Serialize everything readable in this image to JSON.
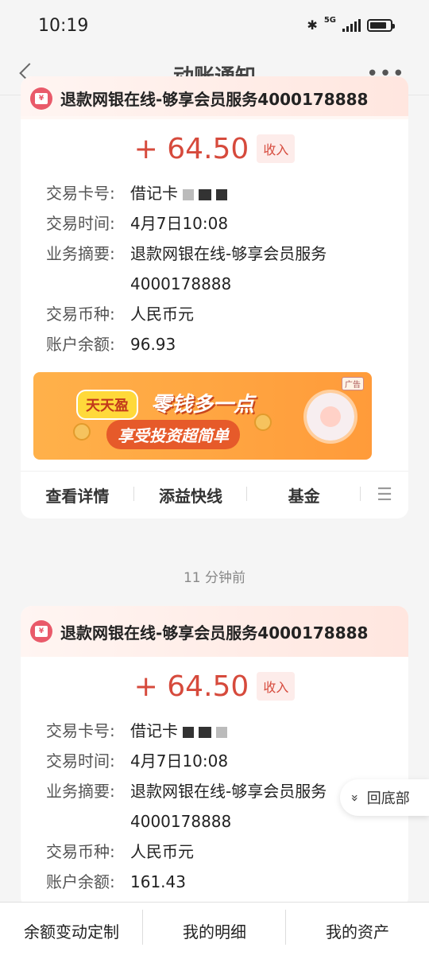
{
  "status": {
    "time": "10:19",
    "network": "5G"
  },
  "nav": {
    "title": "动账通知",
    "more": "•••"
  },
  "cards": [
    {
      "title": "退款网银在线-够享会员服务4000178888",
      "amount": "+ 64.50",
      "tag": "收入",
      "rows": {
        "card_k": "交易卡号:",
        "card_v": "借记卡",
        "time_k": "交易时间:",
        "time_v": "4月7日10:08",
        "memo_k": "业务摘要:",
        "memo_v1": "退款网银在线-够享会员服务",
        "memo_v2": "4000178888",
        "cur_k": "交易币种:",
        "cur_v": "人民币元",
        "bal_k": "账户余额:",
        "bal_v": "96.93"
      },
      "ad": {
        "tag": "广告",
        "logo": "天天盈",
        "line1": "零钱多一点",
        "line2": "享受投资超简单"
      },
      "actions": [
        "查看详情",
        "添益快线",
        "基金"
      ]
    },
    {
      "title": "退款网银在线-够享会员服务4000178888",
      "amount": "+ 64.50",
      "tag": "收入",
      "rows": {
        "card_k": "交易卡号:",
        "card_v": "借记卡",
        "time_k": "交易时间:",
        "time_v": "4月7日10:08",
        "memo_k": "业务摘要:",
        "memo_v1": "退款网银在线-够享会员服务",
        "memo_v2": "4000178888",
        "cur_k": "交易币种:",
        "cur_v": "人民币元",
        "bal_k": "账户余额:",
        "bal_v": "161.43"
      }
    }
  ],
  "timeline": "11 分钟前",
  "float_button": "回底部",
  "bottom_bar": [
    "余额变动定制",
    "我的明细",
    "我的资产"
  ]
}
